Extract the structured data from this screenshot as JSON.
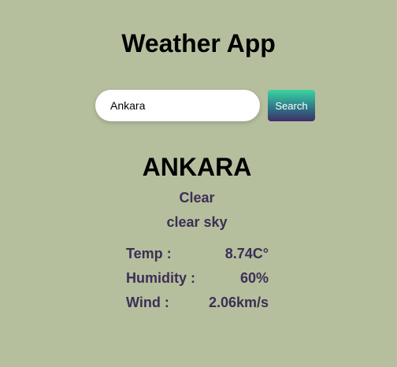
{
  "app": {
    "title": "Weather App"
  },
  "search": {
    "value": "Ankara",
    "button_label": "Search"
  },
  "weather": {
    "city": "ANKARA",
    "main": "Clear",
    "description": "clear sky"
  },
  "stats": [
    {
      "label": "Temp :",
      "value": "8.74C°"
    },
    {
      "label": "Humidity :",
      "value": "60%"
    },
    {
      "label": "Wind :",
      "value": "2.06km/s"
    }
  ],
  "colors": {
    "background": "#b5bf9e",
    "text_accent": "#3d2f54",
    "button_gradient_top": "#3ad6a2",
    "button_gradient_bottom": "#3f2e67"
  }
}
